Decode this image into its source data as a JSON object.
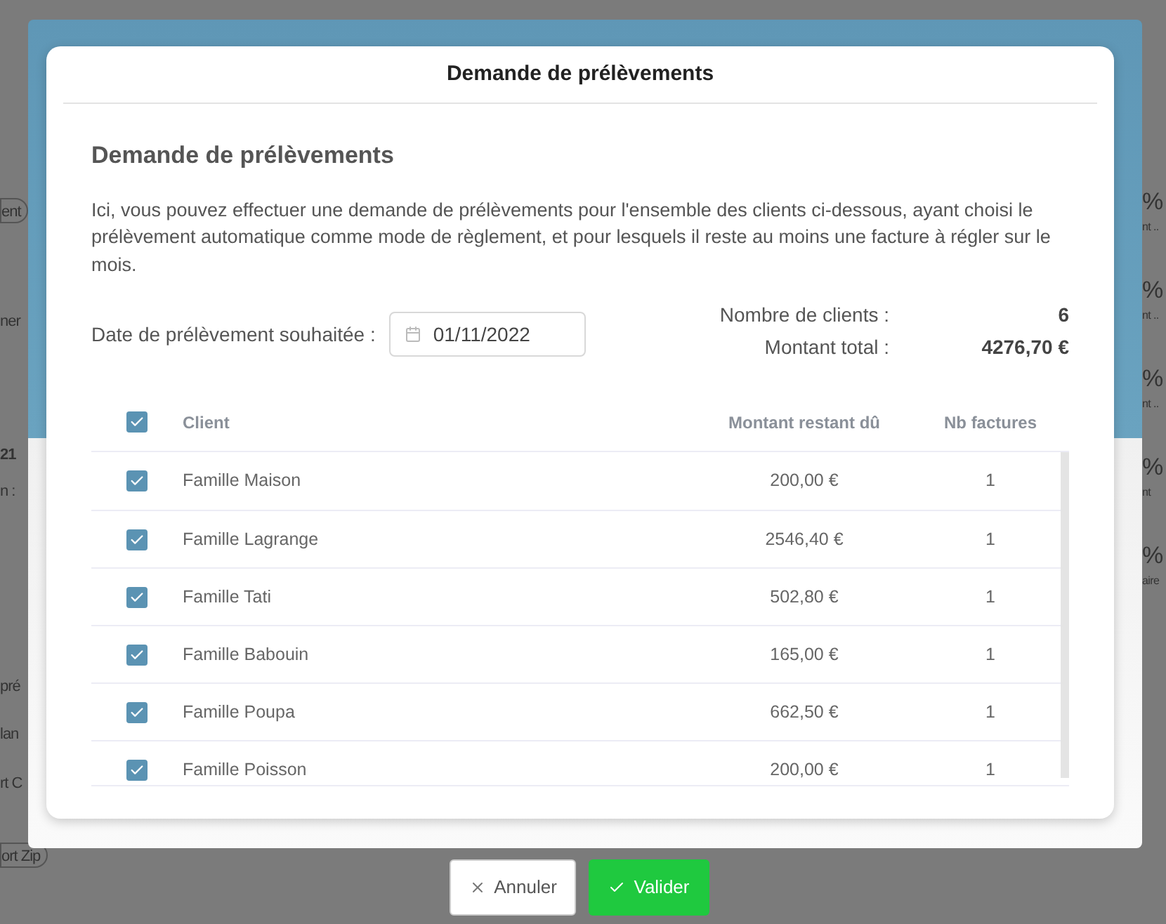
{
  "background": {
    "left": [
      {
        "text": "ent",
        "kind": "button"
      },
      {
        "text": "ner",
        "kind": "text"
      },
      {
        "text": "21",
        "kind": "value"
      },
      {
        "text": "n :",
        "kind": "text"
      },
      {
        "text": "pré",
        "kind": "tab"
      },
      {
        "text": "lan",
        "kind": "link"
      },
      {
        "text": "rt C",
        "kind": "link"
      },
      {
        "text": "ort Zip",
        "kind": "button"
      }
    ],
    "right": [
      {
        "value": "%",
        "label": "nt .."
      },
      {
        "value": "%",
        "label": "nt .."
      },
      {
        "value": "%",
        "label": "nt .."
      },
      {
        "value": "%",
        "label": "nt"
      },
      {
        "value": "%",
        "label": "aire"
      }
    ]
  },
  "dialog": {
    "title": "Demande de prélèvements",
    "heading": "Demande de prélèvements",
    "description": "Ici, vous pouvez effectuer une demande de prélèvements pour l'ensemble des clients ci-dessous, ayant choisi le prélèvement automatique comme mode de règlement, et pour lesquels il reste au moins une facture à régler sur le mois.",
    "date_label": "Date de prélèvement souhaitée :",
    "date_value": "01/11/2022",
    "summary": [
      {
        "label": "Nombre de clients :",
        "value": "6"
      },
      {
        "label": "Montant total :",
        "value": "4276,70 €"
      }
    ]
  },
  "table": {
    "all_checked": true,
    "columns": [
      "Client",
      "Montant restant dû",
      "Nb factures"
    ],
    "rows": [
      {
        "checked": true,
        "client": "Famille Maison",
        "amount": "200,00 €",
        "count": "1"
      },
      {
        "checked": true,
        "client": "Famille Lagrange",
        "amount": "2546,40 €",
        "count": "1"
      },
      {
        "checked": true,
        "client": "Famille Tati",
        "amount": "502,80 €",
        "count": "1"
      },
      {
        "checked": true,
        "client": "Famille Babouin",
        "amount": "165,00 €",
        "count": "1"
      },
      {
        "checked": true,
        "client": "Famille Poupa",
        "amount": "662,50 €",
        "count": "1"
      },
      {
        "checked": true,
        "client": "Famille Poisson",
        "amount": "200,00 €",
        "count": "1"
      }
    ]
  },
  "buttons": [
    {
      "kind": "cancel",
      "label": "Annuler"
    },
    {
      "kind": "confirm",
      "label": "Valider"
    }
  ]
}
